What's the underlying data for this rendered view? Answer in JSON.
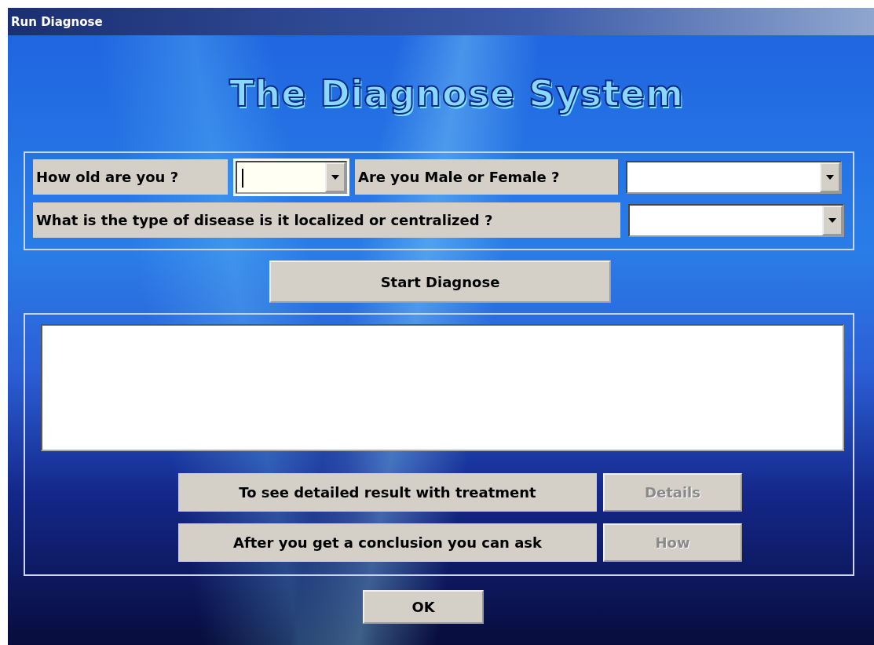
{
  "window": {
    "title": "Run Diagnose"
  },
  "heading": "The Diagnose System",
  "question_rows": [
    [
      {
        "label": "How old are you ?",
        "focused": true
      },
      {
        "label": "Are you Male or Female ?",
        "focused": false
      }
    ],
    [
      {
        "label": "What is the type of disease is it localized or centralized ?",
        "focused": false
      }
    ]
  ],
  "start_button": "Start Diagnose",
  "actions": [
    {
      "label": "To see detailed result with treatment",
      "button": "Details",
      "disabled": true
    },
    {
      "label": "After you get a conclusion you can ask",
      "button": "How",
      "disabled": true
    }
  ],
  "ok_button": "OK"
}
